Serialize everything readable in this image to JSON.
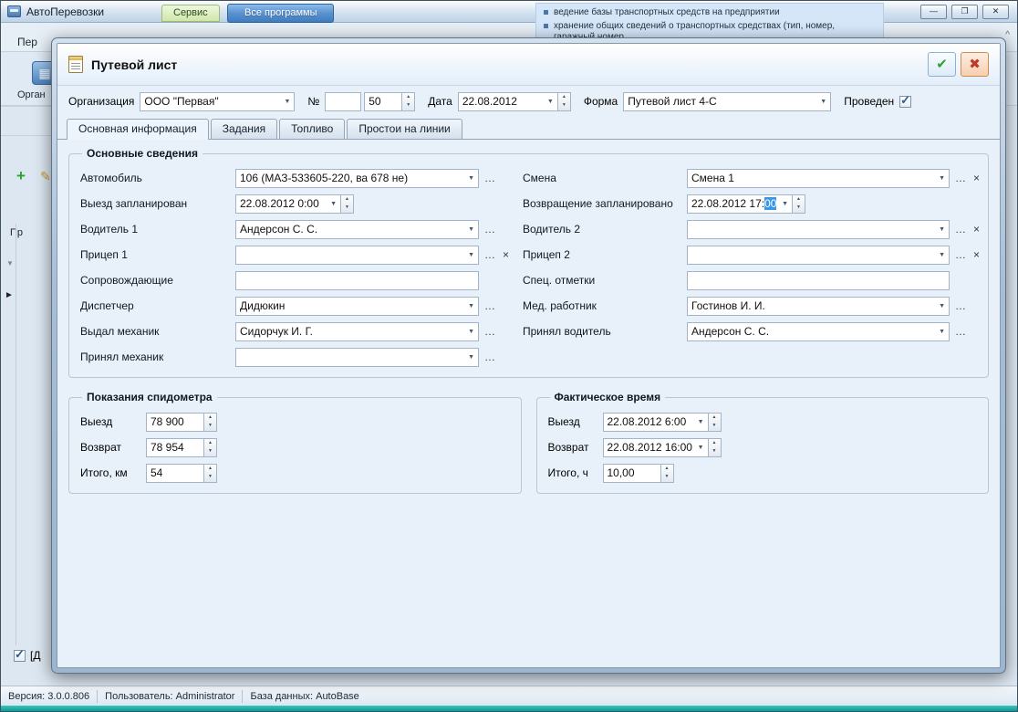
{
  "icons": {
    "dropdown": "▼",
    "spin_up": "▲",
    "spin_down": "▼",
    "ellipsis": "…",
    "clear": "×",
    "ok": "✔",
    "cancel": "✖",
    "minimize": "—",
    "maximize": "❐",
    "close": "✕",
    "check": "✓",
    "add": "+",
    "edit": "✎",
    "row_marker": "►",
    "filter": "▼",
    "collapse": "^",
    "panel_close": "✕",
    "big_tool": "▦"
  },
  "app": {
    "title": "АвтоПеревозки",
    "menu_fragment": "Пер",
    "ribbon_tab_service": "Сервис",
    "ribbon_tab_all_programs": "Все программы",
    "toolbar_caption_fragment": "Орган",
    "grid_header_fragment": "Пр",
    "bottom_checkbox_fragment": "[Д",
    "hints": [
      "ведение базы транспортных средств на предприятии",
      "хранение общих сведений о транспортных средствах (тип, номер, гаражный номер, ..."
    ],
    "statusbar": {
      "version": "Версия: 3.0.0.806",
      "user": "Пользователь: Administrator",
      "database": "База данных: AutoBase"
    }
  },
  "dialog": {
    "title": "Путевой лист",
    "header": {
      "org_label": "Организация",
      "org_value": "ООО \"Первая\"",
      "number_label": "№",
      "number_series": "",
      "number_value": "50",
      "date_label": "Дата",
      "date_value": "22.08.2012",
      "form_label": "Форма",
      "form_value": "Путевой лист 4-С",
      "posted_label": "Проведен"
    },
    "tabs": [
      "Основная информация",
      "Задания",
      "Топливо",
      "Простои на линии"
    ],
    "groups": {
      "main": {
        "title": "Основные сведения",
        "left": [
          {
            "label": "Автомобиль",
            "value": "106 (МАЗ-533605-220, ва 678 не)"
          },
          {
            "label": "Выезд запланирован",
            "value": "22.08.2012 0:00"
          },
          {
            "label": "Водитель 1",
            "value": "Андерсон С. С."
          },
          {
            "label": "Прицеп 1",
            "value": ""
          },
          {
            "label": "Сопровождающие",
            "value": ""
          },
          {
            "label": "Диспетчер",
            "value": "Дидюкин"
          },
          {
            "label": "Выдал механик",
            "value": "Сидорчук И. Г."
          },
          {
            "label": "Принял механик",
            "value": ""
          }
        ],
        "right": [
          {
            "label": "Смена",
            "value": "Смена 1"
          },
          {
            "label": "Возвращение запланировано",
            "value_prefix": "22.08.2012 17:",
            "value_selected": "00"
          },
          {
            "label": "Водитель 2",
            "value": ""
          },
          {
            "label": "Прицеп 2",
            "value": ""
          },
          {
            "label": "Спец. отметки",
            "value": ""
          },
          {
            "label": "Мед. работник",
            "value": "Гостинов И. И."
          },
          {
            "label": "Принял водитель",
            "value": "Андерсон С. С."
          }
        ]
      },
      "odometer": {
        "title": "Показания спидометра",
        "rows": [
          {
            "label": "Выезд",
            "value": "78 900"
          },
          {
            "label": "Возврат",
            "value": "78 954"
          },
          {
            "label": "Итого, км",
            "value": "54"
          }
        ]
      },
      "actual_time": {
        "title": "Фактическое время",
        "rows": [
          {
            "label": "Выезд",
            "value": "22.08.2012 6:00"
          },
          {
            "label": "Возврат",
            "value": "22.08.2012 16:00"
          },
          {
            "label": "Итого, ч",
            "value": "10,00"
          }
        ]
      }
    }
  }
}
